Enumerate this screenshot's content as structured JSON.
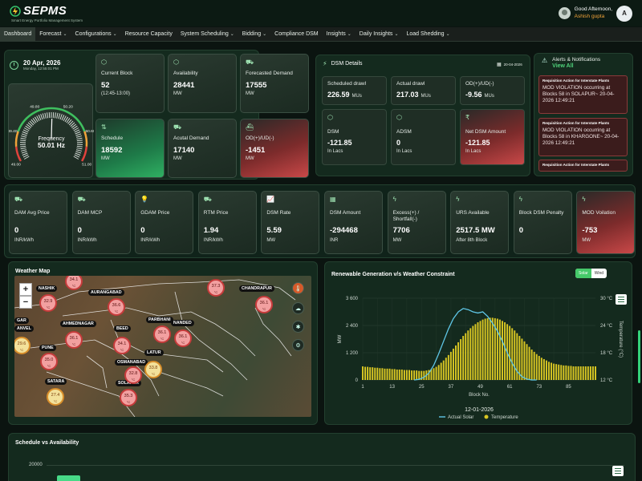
{
  "app": {
    "name": "SEPMS",
    "subtitle": "Smart Energy Portfolio Management System",
    "greeting": "Good Afternoon,",
    "user_name": "Ashish gupta",
    "avatar_letter": "A"
  },
  "nav": [
    {
      "label": "Dashboard",
      "dropdown": false,
      "active": true
    },
    {
      "label": "Forecast",
      "dropdown": true,
      "active": false
    },
    {
      "label": "Configurations",
      "dropdown": true,
      "active": false
    },
    {
      "label": "Resource Capacity",
      "dropdown": false,
      "active": false
    },
    {
      "label": "System Scheduling",
      "dropdown": true,
      "active": false
    },
    {
      "label": "Bidding",
      "dropdown": true,
      "active": false
    },
    {
      "label": "Compliance DSM",
      "dropdown": false,
      "active": false
    },
    {
      "label": "Insights",
      "dropdown": true,
      "active": false
    },
    {
      "label": "Daily Insights",
      "dropdown": true,
      "active": false
    },
    {
      "label": "Load Shedding",
      "dropdown": true,
      "active": false
    }
  ],
  "date": {
    "main": "20 Apr, 2026",
    "sub": "Monday, 12:55:01 PM"
  },
  "gauge": {
    "label": "Frequency",
    "value": "50.01 Hz",
    "value_numeric": 50.01,
    "min": 49.0,
    "max": 51.0,
    "ticks": [
      "49.00",
      "49.40",
      "49.80",
      "50.20",
      "50.60",
      "51.00"
    ]
  },
  "kpi_cards": [
    {
      "label": "Current Block",
      "value": "52",
      "unit": "(12:45-13:00)",
      "style": "default",
      "icon": "cube-icon"
    },
    {
      "label": "Availability",
      "value": "28441",
      "unit": "MW",
      "style": "default",
      "icon": "cube-icon"
    },
    {
      "label": "Forecasted Demand",
      "value": "17555",
      "unit": "MW",
      "style": "default",
      "icon": "truck-icon"
    },
    {
      "label": "Schedule",
      "value": "18592",
      "unit": "MW",
      "style": "green",
      "icon": "sort-icon"
    },
    {
      "label": "Acutal Demand",
      "value": "17140",
      "unit": "MW",
      "style": "default",
      "icon": "truck-icon"
    },
    {
      "label": "OD(+)/UD(-)",
      "value": "-1451",
      "unit": "MW",
      "style": "red",
      "icon": "ship-icon"
    }
  ],
  "dsm": {
    "title": "DSM Details",
    "date": "20-04-2026",
    "row1": [
      {
        "label": "Scheduled drawl",
        "value": "226.59",
        "unit": "MUs"
      },
      {
        "label": "Actual drawl",
        "value": "217.03",
        "unit": "MUs"
      },
      {
        "label": "OD(+)/UD(-)",
        "value": "-9.56",
        "unit": "MUs"
      }
    ],
    "row2": [
      {
        "label": "DSM",
        "value": "-121.85",
        "unit": "In Lacs",
        "style": "default"
      },
      {
        "label": "ADSM",
        "value": "0",
        "unit": "In Lacs",
        "style": "default"
      },
      {
        "label": "Net DSM Amount",
        "value": "-121.85",
        "unit": "In Lacs",
        "style": "red"
      }
    ]
  },
  "alerts": {
    "title": "Alerts & Notifications",
    "view_all": "View All",
    "items": [
      {
        "title": "Requisition Action for Interstate Plants",
        "body": "MOD VIOLATION occurring at Blocks 58 in SOLAPUR~ 20-04-2026 12:49:21"
      },
      {
        "title": "Requisition Action for Interstate Plants",
        "body": "MOD VIOLATION occurring at Blocks 58 in KHARGONE~ 20-04-2026 12:49:21"
      },
      {
        "title": "Requisition Action for Interstate Plants",
        "body": ""
      }
    ]
  },
  "metrics": [
    {
      "label": "DAM Avg Price",
      "value": "0",
      "unit": "INR/kWh",
      "icon": "truck-icon",
      "style": "default"
    },
    {
      "label": "DAM MCP",
      "value": "0",
      "unit": "INR/kWh",
      "icon": "truck-icon",
      "style": "default"
    },
    {
      "label": "GDAM Price",
      "value": "0",
      "unit": "INR/kWh",
      "icon": "bulb-icon",
      "style": "default"
    },
    {
      "label": "RTM Price",
      "value": "1.94",
      "unit": "INR/kWh",
      "icon": "truck-icon",
      "style": "default"
    },
    {
      "label": "DSM Rate",
      "value": "5.59",
      "unit": "MW",
      "icon": "chart-icon",
      "style": "default"
    },
    {
      "label": "DSM Amount",
      "value": "-294468",
      "unit": "INR",
      "icon": "calendar-icon",
      "style": "default"
    },
    {
      "label": "Excess(+) / Shortfall(-)",
      "value": "7706",
      "unit": "MW",
      "icon": "bolt-icon",
      "style": "default"
    },
    {
      "label": "URS Available",
      "value": "2517.5 MW",
      "unit": "After 8th Block",
      "icon": "bolt-icon",
      "style": "default"
    },
    {
      "label": "Block DSM Penalty",
      "value": "0",
      "unit": "",
      "icon": "bolt-icon",
      "style": "default"
    },
    {
      "label": "MOD Voilation",
      "value": "-753",
      "unit": "MW",
      "icon": "bolt-icon",
      "style": "red"
    }
  ],
  "weather": {
    "title": "Weather Map",
    "cities": [
      {
        "name": "NASHIK"
      },
      {
        "name": "AURANGABAD"
      },
      {
        "name": "CHANDRAPUR"
      },
      {
        "name": "AHMEDNAGAR"
      },
      {
        "name": "BEED"
      },
      {
        "name": "PARBHANI"
      },
      {
        "name": "NANDED"
      },
      {
        "name": "PUNE"
      },
      {
        "name": "LATUR"
      },
      {
        "name": "OSMANABAD"
      },
      {
        "name": "SOLAPUR"
      },
      {
        "name": "SATARA"
      },
      {
        "name": "ANVEL"
      },
      {
        "name": "GAR"
      }
    ],
    "temps": [
      {
        "t": "34.1",
        "u": "°C",
        "style": "red"
      },
      {
        "t": "32.9",
        "u": "°C",
        "style": "red"
      },
      {
        "t": "36.6",
        "u": "°C",
        "style": "red"
      },
      {
        "t": "37.3",
        "u": "°C",
        "style": "red"
      },
      {
        "t": "36.1",
        "u": "°C",
        "style": "red"
      },
      {
        "t": "36.1",
        "u": "°C",
        "style": "red"
      },
      {
        "t": "34.1",
        "u": "°C",
        "style": "red"
      },
      {
        "t": "36.1",
        "u": "°C",
        "style": "red"
      },
      {
        "t": "36.1",
        "u": "°C",
        "style": "red"
      },
      {
        "t": "29.6",
        "u": "°C",
        "style": "yellow"
      },
      {
        "t": "35.0",
        "u": "°C",
        "style": "red"
      },
      {
        "t": "33.8",
        "u": "°C",
        "style": "yellow"
      },
      {
        "t": "32.8",
        "u": "°C",
        "style": "red"
      },
      {
        "t": "27.4",
        "u": "°C",
        "style": "yellow"
      },
      {
        "t": "35.3",
        "u": "°C",
        "style": "red"
      }
    ]
  },
  "renewable": {
    "title": "Renewable Generation v/s Weather Constraint",
    "toggles": [
      "Solar",
      "Wind"
    ],
    "date_label": "12-01-2026"
  },
  "schedule_panel": {
    "title": "Schedule vs Availability",
    "y_tick": "20000"
  },
  "chart_data": {
    "type": "bar+line",
    "xlabel": "Block No.",
    "ylabel": "MW",
    "y2label": "Temperature (°C)",
    "ylim": [
      0,
      3600
    ],
    "y2lim": [
      12,
      30
    ],
    "yticks": [
      "0",
      "1 200",
      "2 400",
      "3 600"
    ],
    "y2ticks": [
      "12 °C",
      "18 °C",
      "24 °C",
      "30 °C"
    ],
    "xticks": [
      "1",
      "13",
      "25",
      "37",
      "49",
      "61",
      "73",
      "85"
    ],
    "grid": true,
    "legend_position": "bottom",
    "series": [
      {
        "name": "Actual Solar",
        "type": "line",
        "color": "#5fc6e6",
        "axis": "left",
        "blocks": [
          22,
          24,
          26,
          28,
          30,
          32,
          34,
          36,
          38,
          40,
          42,
          44,
          46,
          48,
          50,
          52,
          54,
          56,
          58,
          60,
          62,
          64,
          66,
          68,
          70,
          72
        ],
        "values": [
          0,
          30,
          120,
          300,
          650,
          1150,
          1700,
          2250,
          2700,
          3000,
          3150,
          3100,
          3000,
          2950,
          3000,
          2800,
          2500,
          2150,
          1700,
          1200,
          750,
          380,
          150,
          40,
          0,
          0
        ]
      },
      {
        "name": "Temperature",
        "type": "bar",
        "color": "#d8c623",
        "axis": "right",
        "values": [
          15.0,
          14.9,
          14.9,
          14.8,
          14.8,
          14.7,
          14.7,
          14.6,
          14.6,
          14.5,
          14.5,
          14.5,
          14.4,
          14.4,
          14.3,
          14.3,
          14.3,
          14.2,
          14.2,
          14.2,
          14.1,
          14.1,
          14.1,
          14.0,
          14.0,
          14.0,
          14.1,
          14.2,
          14.4,
          14.6,
          14.9,
          15.3,
          15.8,
          16.3,
          16.9,
          17.5,
          18.2,
          18.9,
          19.6,
          20.3,
          21.0,
          21.7,
          22.3,
          22.9,
          23.4,
          23.9,
          24.3,
          24.7,
          25.0,
          25.3,
          25.5,
          25.6,
          25.7,
          25.7,
          25.6,
          25.5,
          25.3,
          25.0,
          24.7,
          24.3,
          23.9,
          23.4,
          22.9,
          22.3,
          21.7,
          21.1,
          20.5,
          19.9,
          19.3,
          18.7,
          18.2,
          17.7,
          17.3,
          16.9,
          16.6,
          16.3,
          16.0,
          15.8,
          15.6,
          15.5,
          15.4,
          15.3,
          15.2,
          15.2,
          15.1,
          15.1,
          15.0,
          15.0,
          15.0,
          15.0,
          15.0,
          15.0,
          15.0,
          15.0,
          15.0,
          15.0
        ]
      }
    ]
  }
}
